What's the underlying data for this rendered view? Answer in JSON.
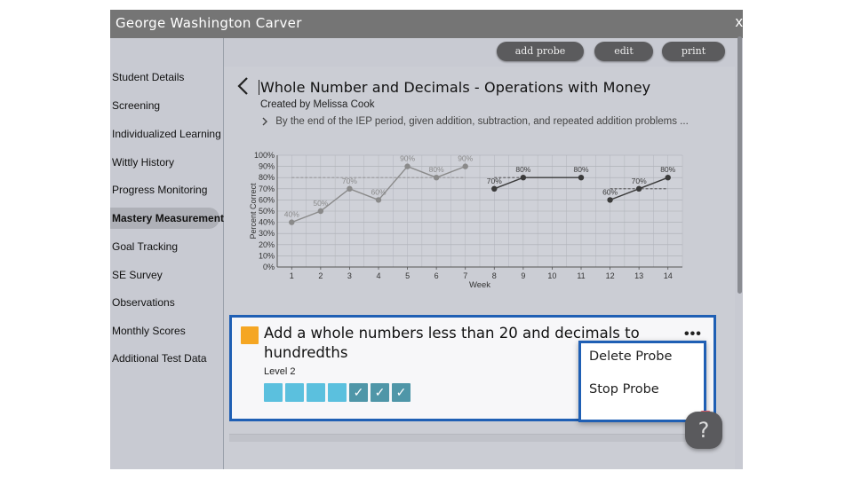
{
  "window": {
    "title": "George Washington Carver",
    "close_label": "x"
  },
  "sidebar": {
    "items": [
      {
        "label": "Student Details"
      },
      {
        "label": "Screening"
      },
      {
        "label": "Individualized Learning"
      },
      {
        "label": "Wittly History"
      },
      {
        "label": "Progress Monitoring"
      },
      {
        "label": "Mastery Measurement",
        "active": true
      },
      {
        "label": "Goal Tracking"
      },
      {
        "label": "SE Survey"
      },
      {
        "label": "Observations"
      },
      {
        "label": "Monthly Scores"
      },
      {
        "label": "Additional Test Data"
      }
    ]
  },
  "toolbar": {
    "add_probe": "add probe",
    "edit": "edit",
    "print": "print"
  },
  "header": {
    "back_icon": "chevron-left-icon",
    "title": "Whole Number and Decimals - Operations with Money",
    "created_by": "Created by Melissa Cook",
    "goal_icon": "chevron-right-icon",
    "goal": "By the end of the IEP period, given addition, subtraction, and repeated addition problems ..."
  },
  "chart_data": {
    "type": "line",
    "xlabel": "Week",
    "ylabel": "Percent Correct",
    "ylim": [
      0,
      100
    ],
    "y_ticks": [
      "0%",
      "10%",
      "20%",
      "30%",
      "40%",
      "50%",
      "60%",
      "70%",
      "80%",
      "90%",
      "100%"
    ],
    "x_ticks": [
      "1",
      "2",
      "3",
      "4",
      "5",
      "6",
      "7",
      "8",
      "9",
      "10",
      "11",
      "12",
      "13",
      "14"
    ],
    "grid": true,
    "series": [
      {
        "x": [
          1,
          2,
          3,
          4,
          5,
          6,
          7
        ],
        "y": [
          40,
          50,
          70,
          60,
          90,
          80,
          90
        ],
        "labels": [
          "40%",
          "50%",
          "70%",
          "60%",
          "90%",
          "80%",
          "90%"
        ],
        "color": "#8a8a8a",
        "goal": {
          "x": [
            1,
            7
          ],
          "y": 80
        }
      },
      {
        "x": [
          8,
          9,
          11
        ],
        "y": [
          70,
          80,
          80
        ],
        "labels": [
          "70%",
          "80%",
          "80%"
        ],
        "color": "#3a3a3a",
        "goal": {
          "x": [
            8,
            9
          ],
          "y": 80
        }
      },
      {
        "x": [
          12,
          13,
          14
        ],
        "y": [
          60,
          70,
          80
        ],
        "labels": [
          "60%",
          "70%",
          "80%"
        ],
        "color": "#3a3a3a",
        "goal": {
          "x": [
            12,
            14
          ],
          "y": 70
        }
      }
    ]
  },
  "card": {
    "color": "#f5a623",
    "title": "Add a whole numbers less than 20 and decimals to hundredths",
    "level": "Level 2",
    "more_label": "•••",
    "checkmark": "✓",
    "progress": [
      false,
      false,
      false,
      false,
      true,
      true,
      true
    ]
  },
  "context_menu": {
    "delete": "Delete Probe",
    "stop": "Stop Probe"
  },
  "help": {
    "label": "?"
  }
}
